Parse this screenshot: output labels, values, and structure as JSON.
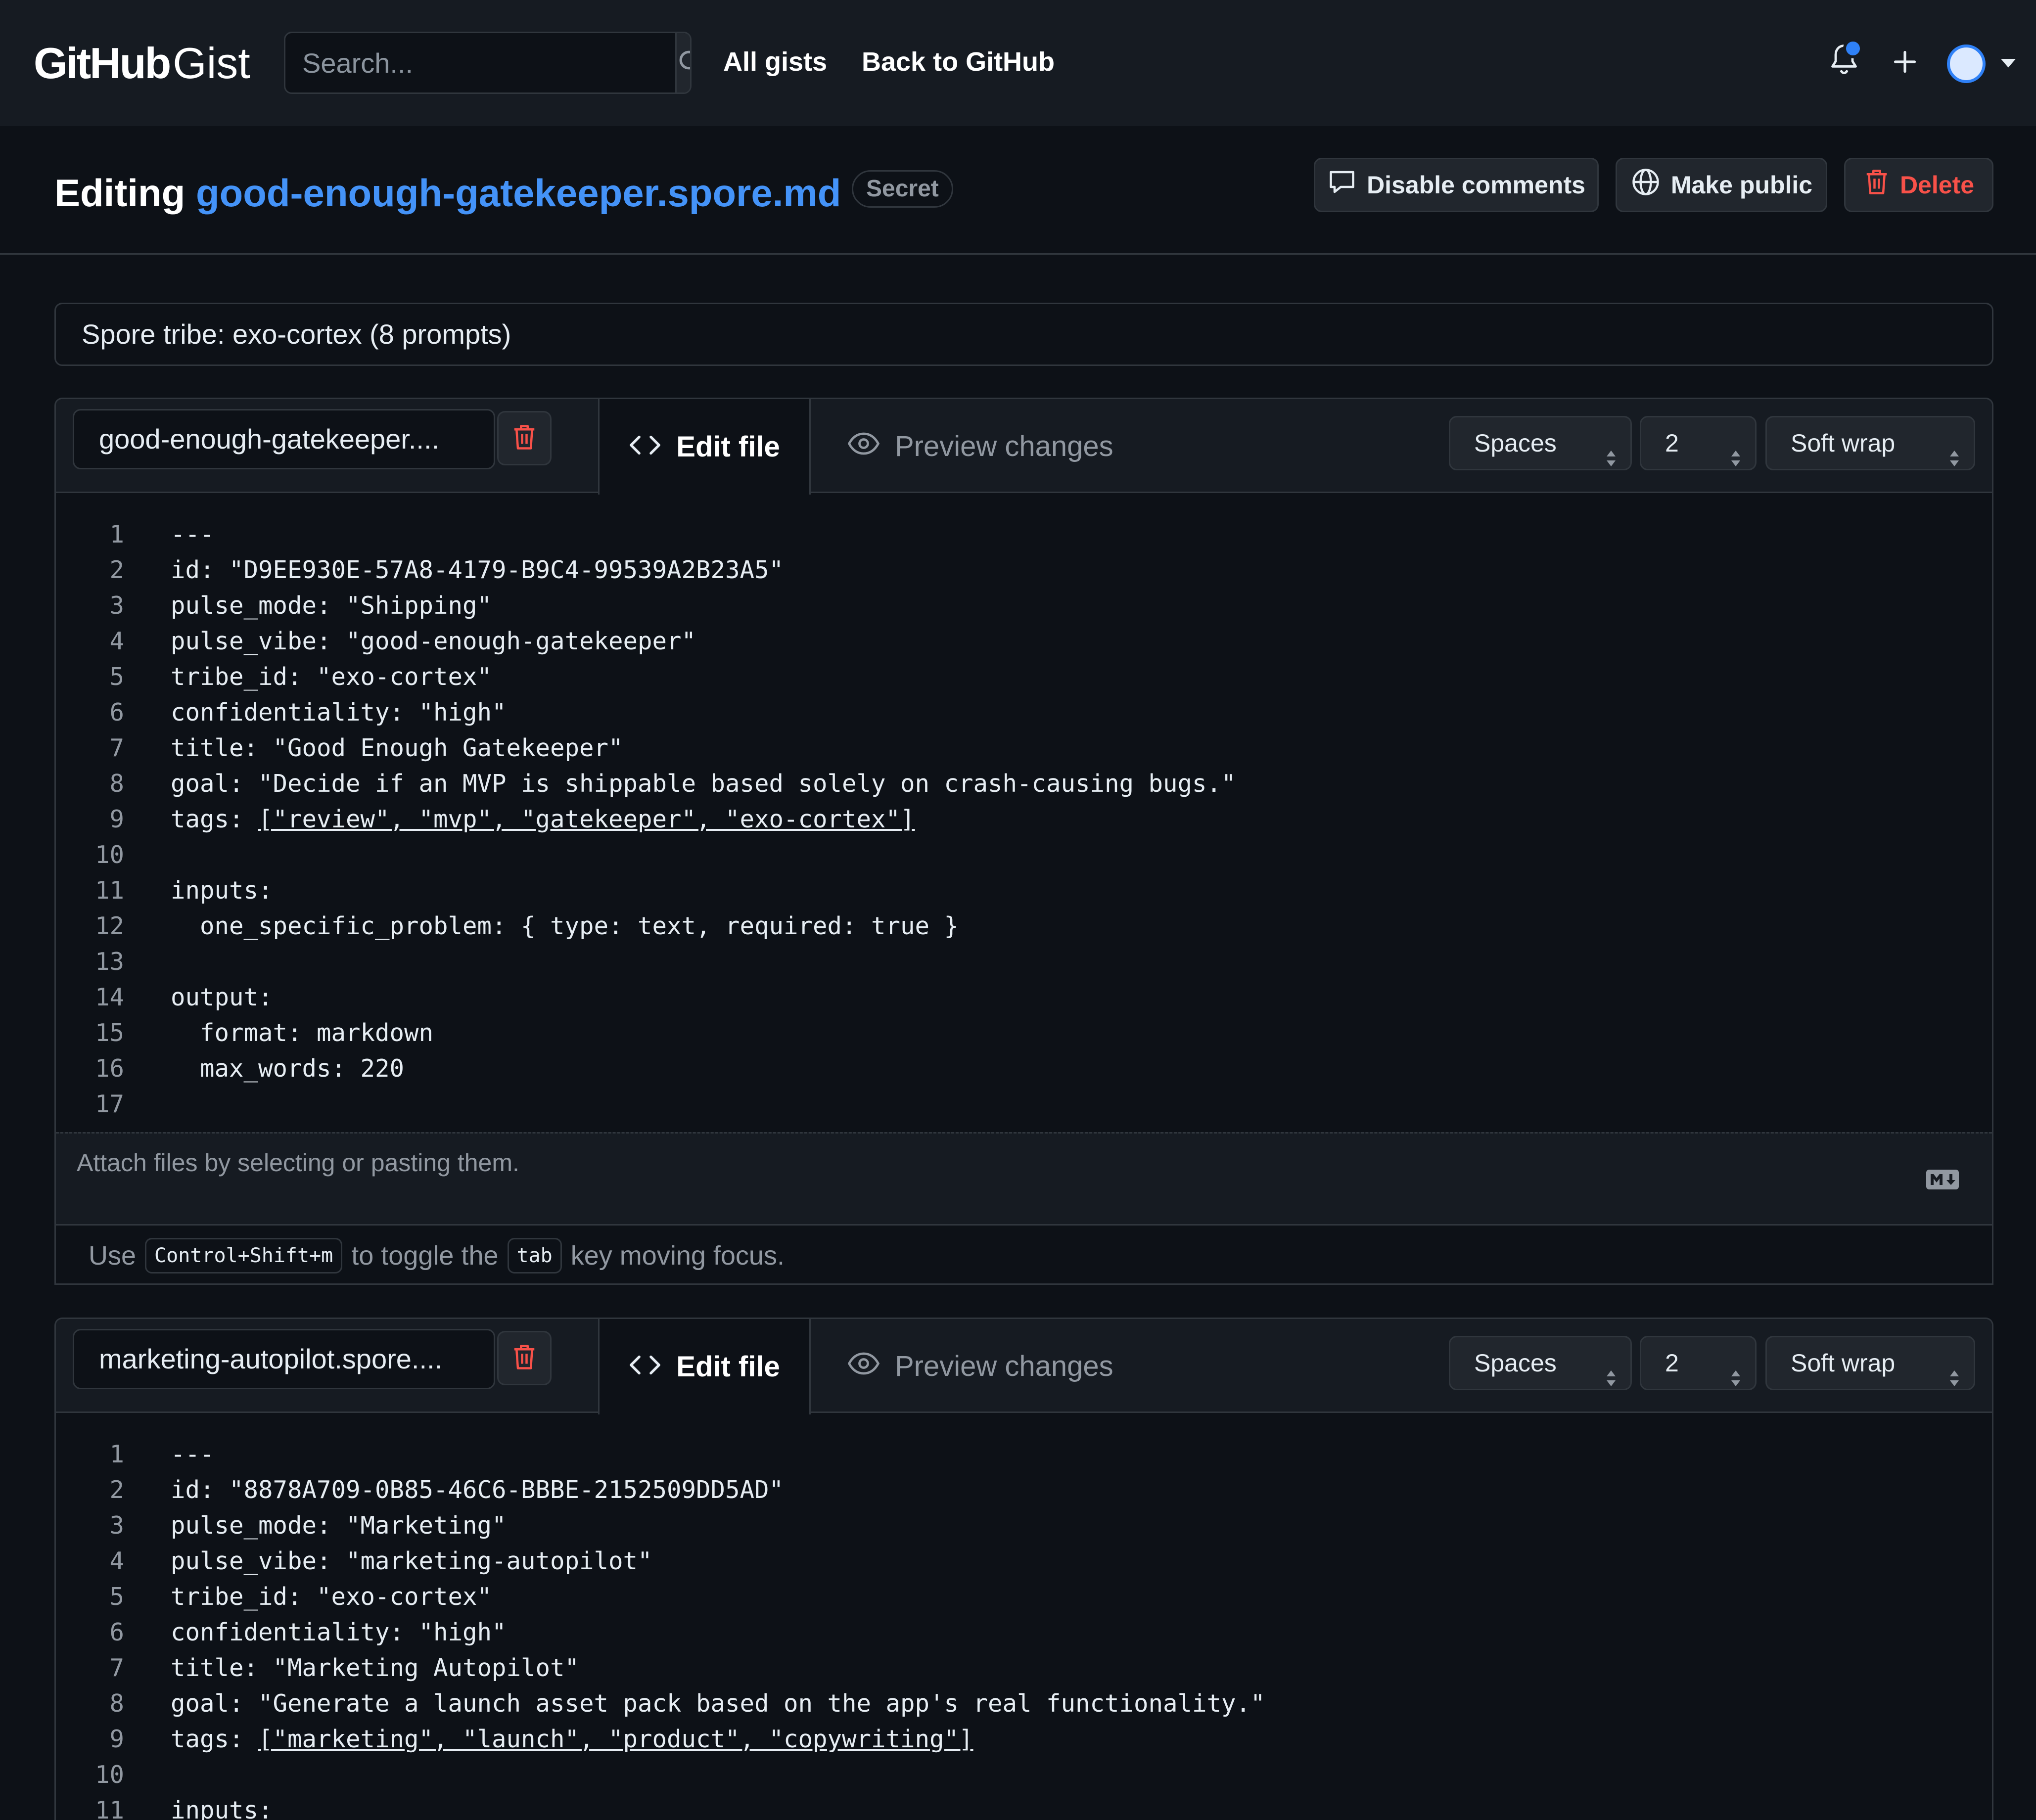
{
  "header": {
    "brand_github": "GitHub",
    "brand_gist": "Gist",
    "search_placeholder": "Search...",
    "nav": [
      "All gists",
      "Back to GitHub"
    ]
  },
  "title_row": {
    "prefix": "Editing",
    "filename": "good-enough-gatekeeper.spore.md",
    "badge": "Secret",
    "buttons": {
      "disable_comments": "Disable comments",
      "make_public": "Make public",
      "delete": "Delete"
    }
  },
  "description": "Spore tribe: exo-cortex (8 prompts)",
  "files": [
    {
      "filename": "good-enough-gatekeeper....",
      "tab_edit": "Edit file",
      "tab_preview": "Preview changes",
      "indent_mode": "Spaces",
      "indent_size": "2",
      "wrap_mode": "Soft wrap",
      "lines": [
        "---",
        "id: \"D9EE930E-57A8-4179-B9C4-99539A2B23A5\"",
        "pulse_mode: \"Shipping\"",
        "pulse_vibe: \"good-enough-gatekeeper\"",
        "tribe_id: \"exo-cortex\"",
        "confidentiality: \"high\"",
        "title: \"Good Enough Gatekeeper\"",
        "goal: \"Decide if an MVP is shippable based solely on crash-causing bugs.\"",
        "tags: [\"review\", \"mvp\", \"gatekeeper\", \"exo-cortex\"]",
        "",
        "inputs:",
        "  one_specific_problem: { type: text, required: true }",
        "",
        "output:",
        "  format: markdown",
        "  max_words: 220",
        ""
      ],
      "line_numbers": [
        "1",
        "2",
        "3",
        "4",
        "5",
        "6",
        "7",
        "8",
        "9",
        "10",
        "11",
        "12",
        "13",
        "14",
        "15",
        "16",
        "17"
      ],
      "attach_text": "Attach files by selecting or pasting them.",
      "hint": {
        "use": "Use",
        "shortcut": "Control+Shift+m",
        "middle": "to toggle the",
        "key": "tab",
        "end": "key moving focus."
      }
    },
    {
      "filename": "marketing-autopilot.spore....",
      "tab_edit": "Edit file",
      "tab_preview": "Preview changes",
      "indent_mode": "Spaces",
      "indent_size": "2",
      "wrap_mode": "Soft wrap",
      "lines": [
        "---",
        "id: \"8878A709-0B85-46C6-BBBE-2152509DD5AD\"",
        "pulse_mode: \"Marketing\"",
        "pulse_vibe: \"marketing-autopilot\"",
        "tribe_id: \"exo-cortex\"",
        "confidentiality: \"high\"",
        "title: \"Marketing Autopilot\"",
        "goal: \"Generate a launch asset pack based on the app's real functionality.\"",
        "tags: [\"marketing\", \"launch\", \"product\", \"copywriting\"]",
        "",
        "inputs:"
      ],
      "line_numbers": [
        "1",
        "2",
        "3",
        "4",
        "5",
        "6",
        "7",
        "8",
        "9",
        "10",
        "11"
      ]
    }
  ],
  "colors": {
    "accent_link": "#4493f8",
    "danger": "#f85149",
    "notification": "#2f81f7"
  }
}
